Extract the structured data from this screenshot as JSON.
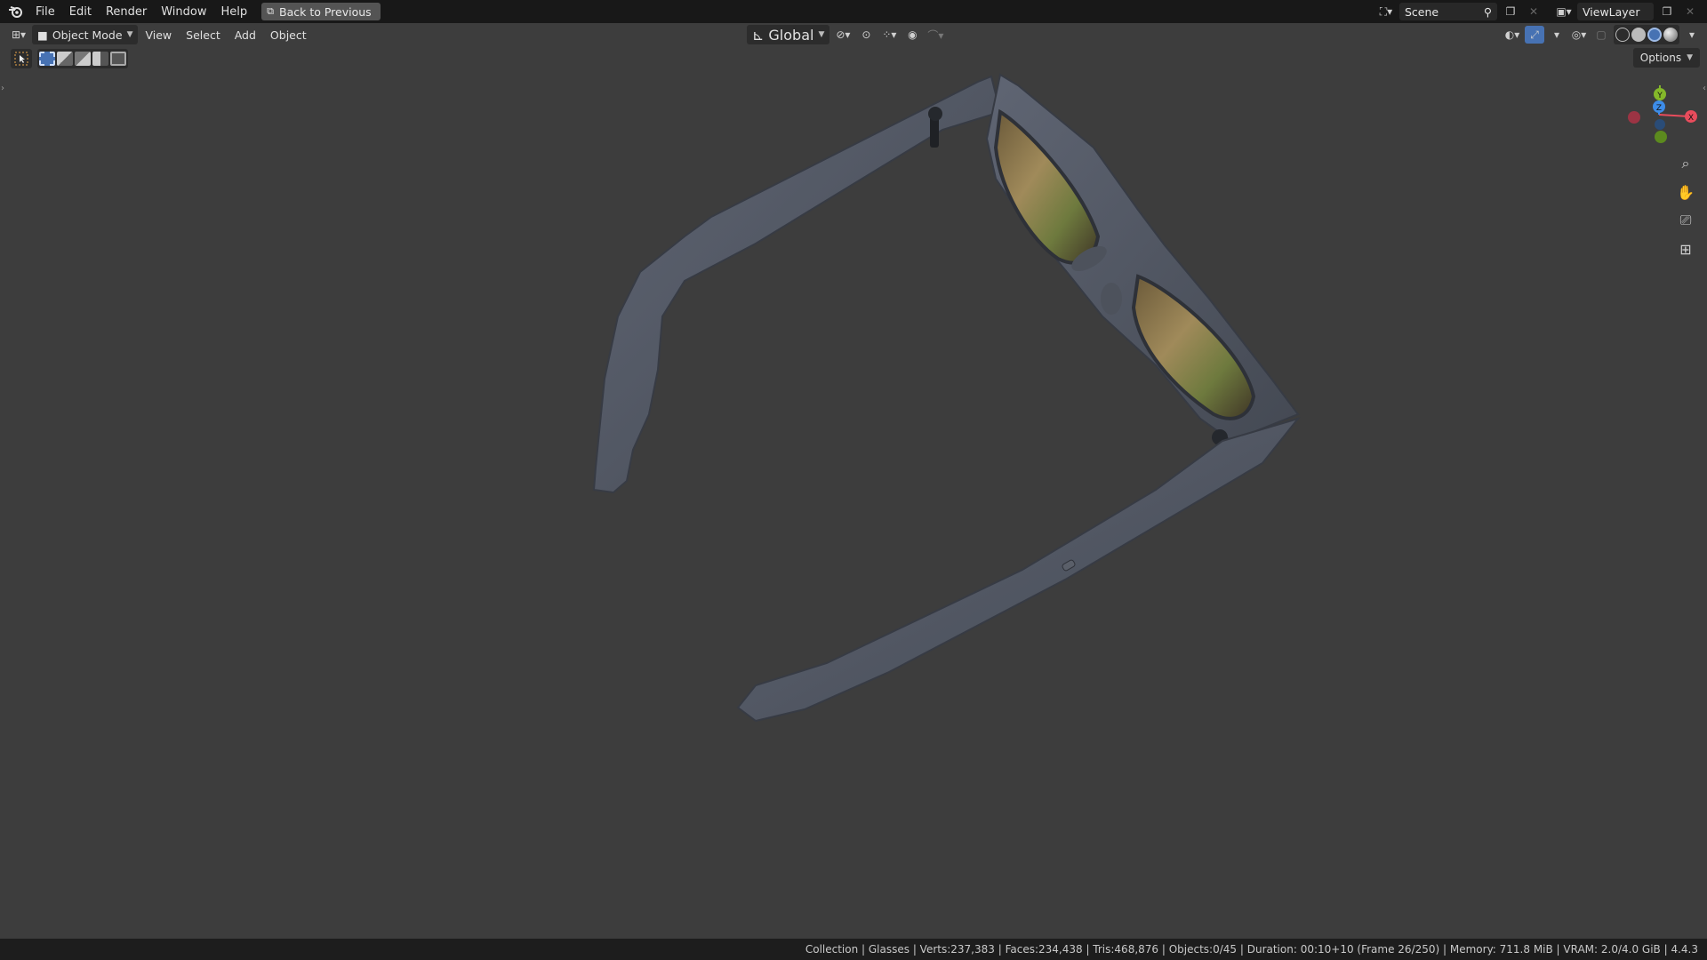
{
  "menubar": {
    "items": [
      "File",
      "Edit",
      "Render",
      "Window",
      "Help"
    ],
    "back_button": "Back to Previous",
    "scene_name": "Scene",
    "view_layer": "ViewLayer"
  },
  "viewport_header": {
    "mode": "Object Mode",
    "menus": [
      "View",
      "Select",
      "Add",
      "Object"
    ],
    "transform_orientation": "Global",
    "options_label": "Options"
  },
  "gizmo": {
    "axes": [
      "Y",
      "Z",
      "X"
    ],
    "colors": {
      "x": "#e84c5c",
      "y": "#84b82a",
      "z": "#3d8ce8"
    }
  },
  "statusbar": {
    "text": "Collection | Glasses | Verts:237,383 | Faces:234,438 | Tris:468,876 | Objects:0/45 | Duration: 00:10+10 (Frame 26/250) | Memory: 711.8 MiB | VRAM: 2.0/4.0 GiB | 4.4.3"
  },
  "colors": {
    "accent": "#4772b3",
    "viewport_bg": "#3d3d3d",
    "header_bg": "#181818"
  }
}
